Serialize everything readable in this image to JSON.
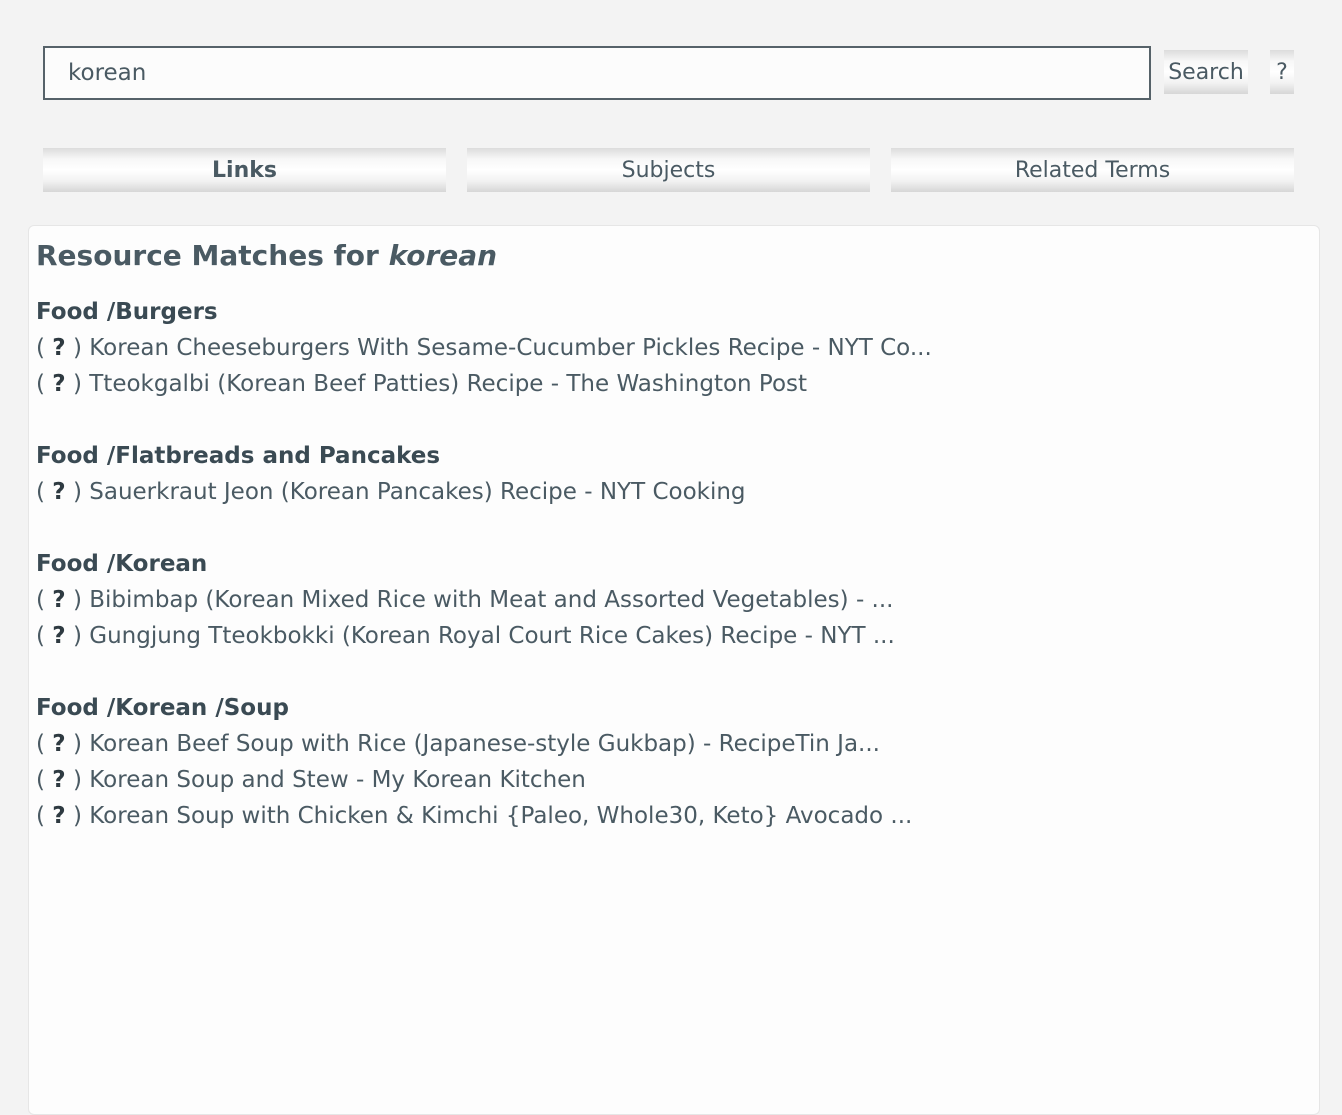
{
  "search": {
    "value": "korean",
    "button_label": "Search",
    "help_label": "?"
  },
  "tabs": [
    {
      "label": "Links",
      "active": true
    },
    {
      "label": "Subjects",
      "active": false
    },
    {
      "label": "Related Terms",
      "active": false
    }
  ],
  "results": {
    "heading_prefix": "Resource Matches for",
    "term": "korean",
    "groups": [
      {
        "title": "Food /Burgers",
        "links": [
          "Korean Cheeseburgers With Sesame-Cucumber Pickles Recipe - NYT Co...",
          "Tteokgalbi (Korean Beef Patties) Recipe - The Washington Post"
        ]
      },
      {
        "title": "Food /Flatbreads and Pancakes",
        "links": [
          "Sauerkraut Jeon (Korean Pancakes) Recipe - NYT Cooking"
        ]
      },
      {
        "title": "Food /Korean",
        "links": [
          "Bibimbap (Korean Mixed Rice with Meat and Assorted Vegetables) - ...",
          "Gungjung Tteokbokki (Korean Royal Court Rice Cakes) Recipe - NYT ..."
        ]
      },
      {
        "title": "Food /Korean /Soup",
        "links": [
          "Korean Beef Soup with Rice (Japanese-style Gukbap) - RecipeTin Ja...",
          "Korean Soup and Stew - My Korean Kitchen",
          "Korean Soup with Chicken & Kimchi {Paleo, Whole30, Keto} Avocado ..."
        ]
      }
    ],
    "help_marker": {
      "open": "( ",
      "q": "?",
      "close": " ) "
    }
  }
}
